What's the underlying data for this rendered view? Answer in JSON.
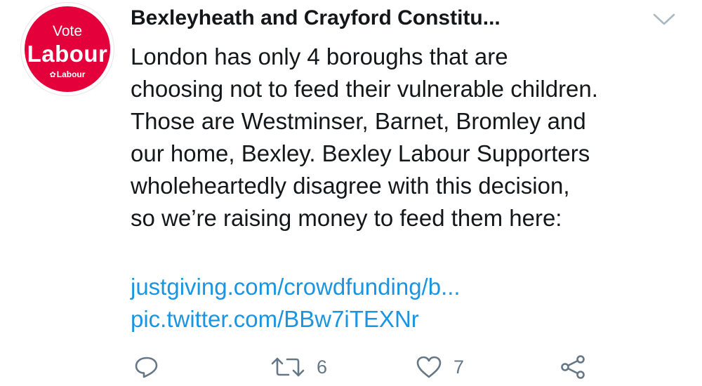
{
  "author": {
    "display_name": "Bexleyheath and Crayford Constitu...",
    "avatar": {
      "line1": "Vote",
      "line2": "Labour",
      "logo_text": "Labour",
      "color": "#e4003b"
    }
  },
  "tweet": {
    "lines": [
      "London has only 4 boroughs that are",
      "choosing not to feed their vulnerable children.",
      "Those are Westminser, Barnet, Bromley and",
      "our home, Bexley. Bexley Labour Supporters",
      "wholeheartedly disagree with this decision,",
      "so we’re raising money to feed them here:"
    ],
    "link_text": "justgiving.com/crowdfunding/b...",
    "pic_link_text": "pic.twitter.com/BBw7iTEXNr"
  },
  "actions": {
    "reply": {
      "icon": "reply-icon"
    },
    "retweet": {
      "icon": "retweet-icon",
      "count": "6"
    },
    "like": {
      "icon": "heart-icon",
      "count": "7"
    },
    "share": {
      "icon": "share-icon"
    }
  },
  "colors": {
    "text": "#14171a",
    "link": "#1b95e0",
    "muted": "#657786"
  }
}
